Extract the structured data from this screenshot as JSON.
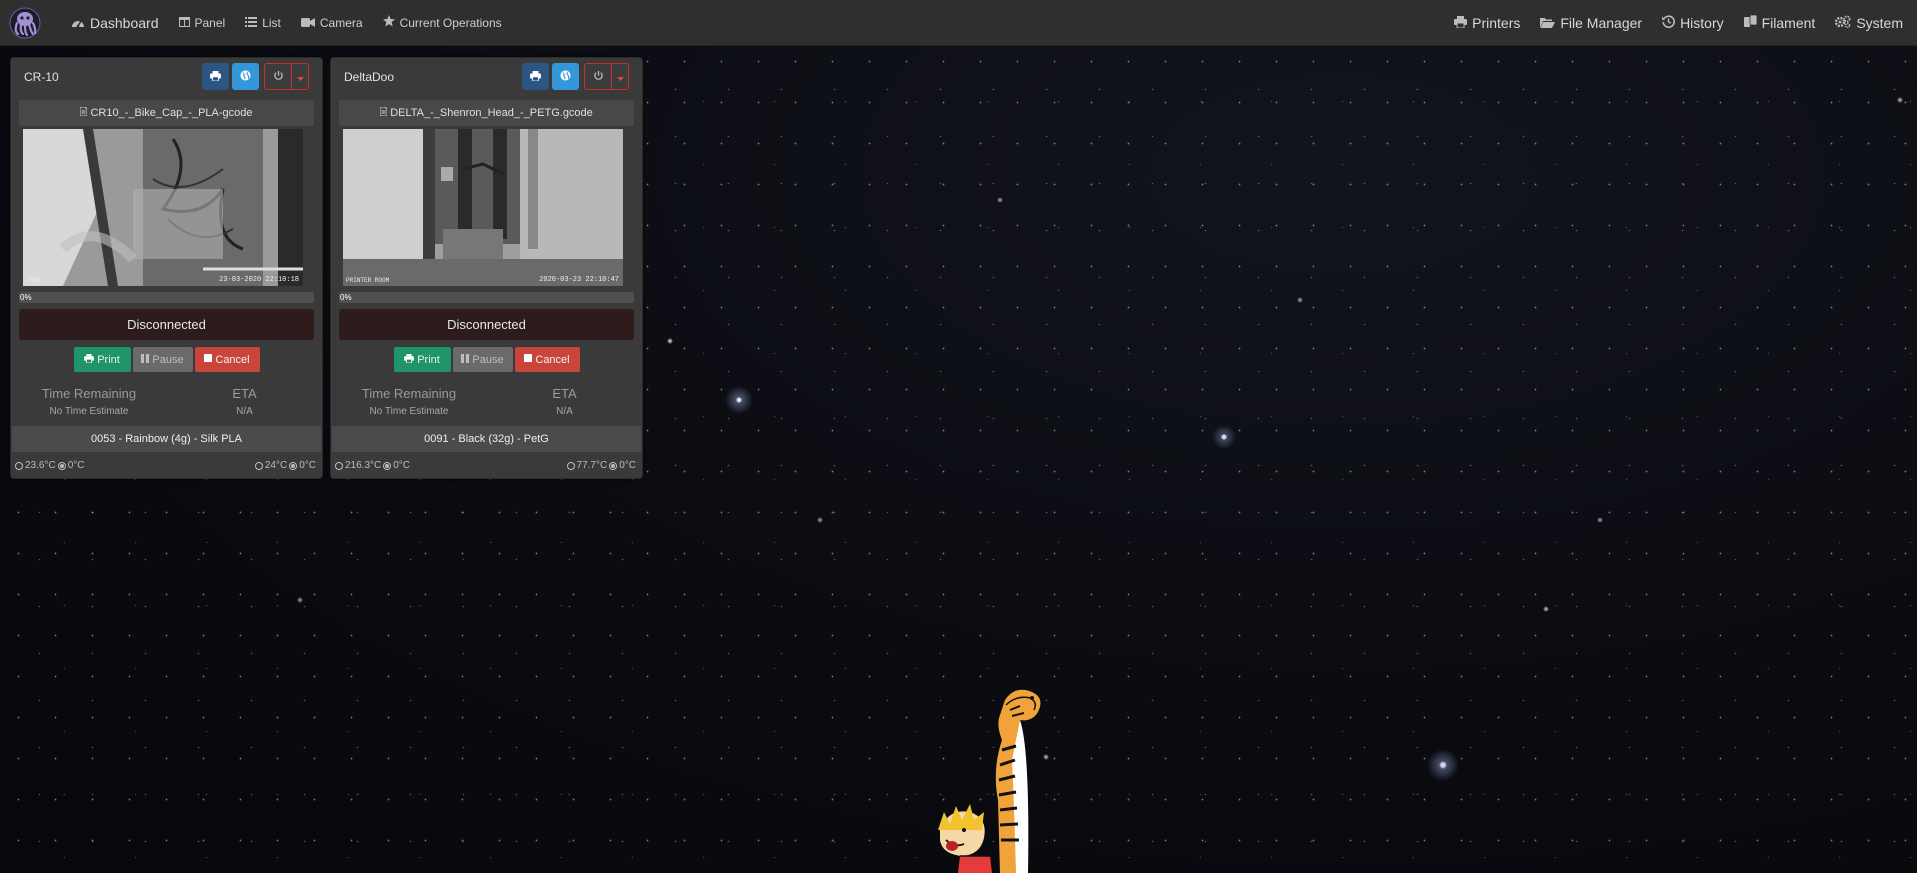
{
  "navbar": {
    "left": [
      {
        "label": "Dashboard",
        "icon": "dashboard-icon"
      },
      {
        "label": "Panel",
        "icon": "panel-icon"
      },
      {
        "label": "List",
        "icon": "list-icon"
      },
      {
        "label": "Camera",
        "icon": "camera-icon"
      },
      {
        "label": "Current Operations",
        "icon": "star-icon"
      }
    ],
    "right": [
      {
        "label": "Printers",
        "icon": "printer-icon"
      },
      {
        "label": "File Manager",
        "icon": "folder-open-icon"
      },
      {
        "label": "History",
        "icon": "history-icon"
      },
      {
        "label": "Filament",
        "icon": "spool-icon"
      },
      {
        "label": "System",
        "icon": "cogs-icon"
      }
    ]
  },
  "printers": [
    {
      "name": "CR-10",
      "file": "CR10_-_Bike_Cap_-_PLA-gcode",
      "camera_timestamp": "23-03-2020 22:10:18",
      "camera_label": "CR10",
      "progress": 0,
      "progress_text": "0%",
      "status": "Disconnected",
      "buttons": {
        "print": "Print",
        "pause": "Pause",
        "cancel": "Cancel"
      },
      "time_remaining_label": "Time Remaining",
      "time_remaining_value": "No Time Estimate",
      "eta_label": "ETA",
      "eta_value": "N/A",
      "filament": "0053 - Rainbow (4g) - Silk PLA",
      "temps": {
        "tool_actual": "23.6°C",
        "bed_actual": "0°C",
        "tool_target": "24°C",
        "bed_target": "0°C"
      }
    },
    {
      "name": "DeltaDoo",
      "file": "DELTA_-_Shenron_Head_-_PETG.gcode",
      "camera_timestamp": "2020-03-23 22:10:47",
      "camera_label": "PRINTER ROOM",
      "progress": 0,
      "progress_text": "0%",
      "status": "Disconnected",
      "buttons": {
        "print": "Print",
        "pause": "Pause",
        "cancel": "Cancel"
      },
      "time_remaining_label": "Time Remaining",
      "time_remaining_value": "No Time Estimate",
      "eta_label": "ETA",
      "eta_value": "N/A",
      "filament": "0091 - Black (32g) - PetG",
      "temps": {
        "tool_actual": "216.3°C",
        "bed_actual": "0°C",
        "tool_target": "77.7°C",
        "bed_target": "0°C"
      }
    }
  ],
  "colors": {
    "navbar": "#2f2f2f",
    "card": "#3a3a3a",
    "print_button": "#1e9468",
    "cancel_button": "#c9443b",
    "disconnected_bg": "#2e1b1c",
    "header_print": "#2c5582",
    "header_web": "#3497db"
  }
}
